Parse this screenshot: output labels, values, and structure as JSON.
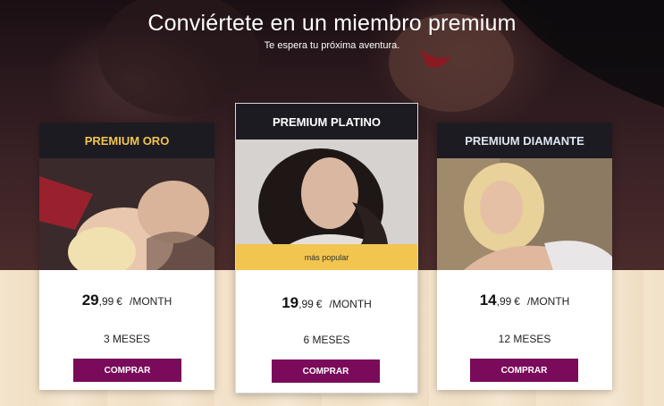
{
  "hero": {
    "title": "Conviértete en un miembro premium",
    "subtitle": "Te espera tu próxima aventura."
  },
  "plans": [
    {
      "name": "PREMIUM ORO",
      "name_color": "#f1c54f",
      "price_int": "29",
      "price_dec": ",99",
      "currency": "€",
      "period": "/MONTH",
      "duration": "3 MESES",
      "button": "COMPRAR"
    },
    {
      "name": "PREMIUM PLATINO",
      "name_color": "#ffffff",
      "price_int": "19",
      "price_dec": ",99",
      "currency": "€",
      "period": "/MONTH",
      "duration": "6 MESES",
      "button": "COMPRAR",
      "badge": "más popular"
    },
    {
      "name": "PREMIUM DIAMANTE",
      "name_color": "#dfe6f2",
      "price_int": "14",
      "price_dec": ",99",
      "currency": "€",
      "period": "/MONTH",
      "duration": "12 MESES",
      "button": "COMPRAR"
    }
  ],
  "colors": {
    "button": "#7a0a5a",
    "badge": "#f1c54f",
    "card_header": "#1c1b22"
  }
}
